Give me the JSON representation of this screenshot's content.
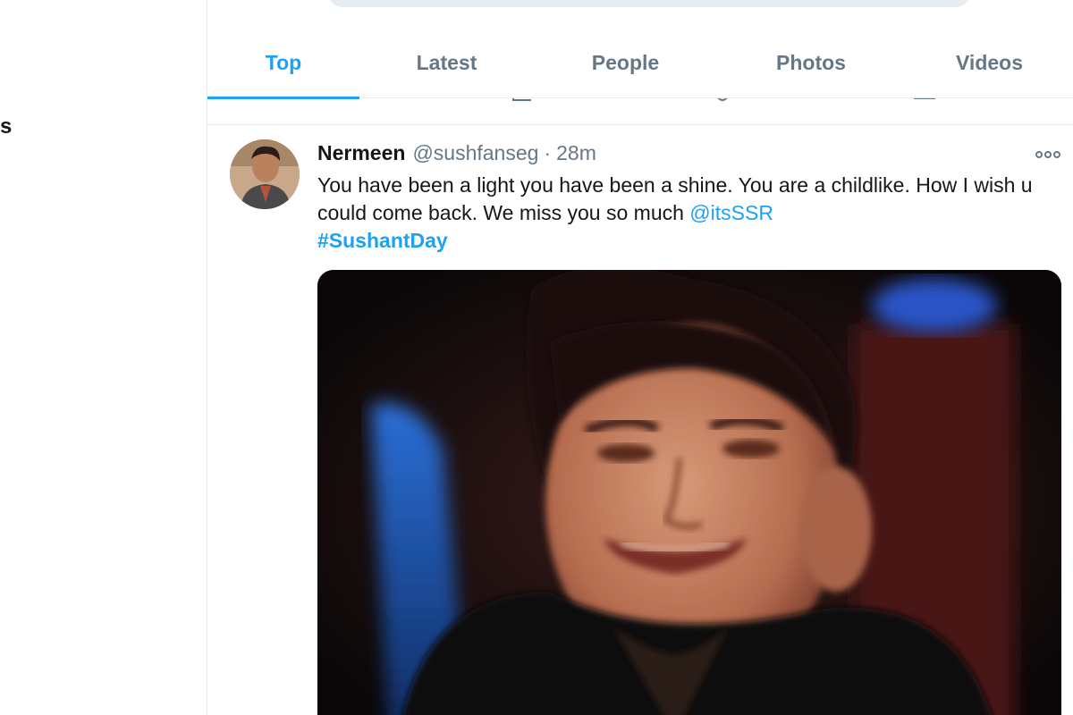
{
  "sidebar": {
    "fragment_text": "s"
  },
  "tabs": [
    {
      "label": "Top",
      "active": true
    },
    {
      "label": "Latest",
      "active": false
    },
    {
      "label": "People",
      "active": false
    },
    {
      "label": "Photos",
      "active": false
    },
    {
      "label": "Videos",
      "active": false
    }
  ],
  "tweet": {
    "name": "Nermeen",
    "handle": "@sushfanseg",
    "separator": "·",
    "time": "28m",
    "text": "You have been a light you have been a shine. You are a childlike. How I wish u could come back. We miss you so much ",
    "mention": "@itsSSR",
    "hashtag": "#SushantDay",
    "media_type": "video",
    "more_icon": "more-dots-icon"
  },
  "colors": {
    "accent": "#1da1f2",
    "muted": "#657786",
    "text": "#14171a",
    "divider": "#e6ecf0"
  }
}
